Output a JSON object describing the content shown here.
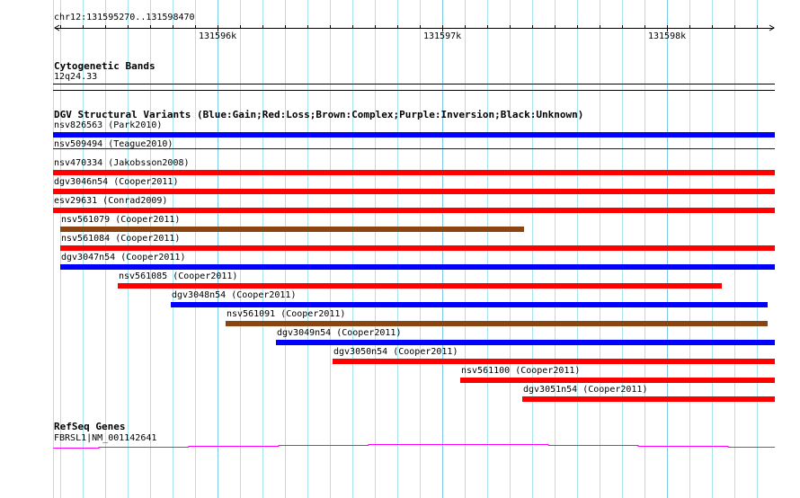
{
  "ruler": {
    "range_label": "chr12:131595270..131598470",
    "ticks": [
      "131596k",
      "131597k",
      "131598k"
    ]
  },
  "tracks": {
    "cytoband": {
      "title": "Cytogenetic Bands",
      "feature": "12q24.33"
    },
    "dgv": {
      "title": "DGV Structural Variants (Blue:Gain;Red:Loss;Brown:Complex;Purple:Inversion;Black:Unknown)",
      "colors": {
        "gain": "#0000ff",
        "loss": "#ff0000",
        "complex": "#8b4513"
      },
      "features": [
        {
          "label": "nsv826563 (Park2010)",
          "type": "gain"
        },
        {
          "label": "nsv509494 (Teague2010)",
          "type": "gain"
        },
        {
          "label": "nsv470334 (Jakobsson2008)",
          "type": "loss"
        },
        {
          "label": "dgv3046n54 (Cooper2011)",
          "type": "loss"
        },
        {
          "label": "esv29631 (Conrad2009)",
          "type": "loss"
        },
        {
          "label": "nsv561079 (Cooper2011)",
          "type": "complex"
        },
        {
          "label": "nsv561084 (Cooper2011)",
          "type": "loss"
        },
        {
          "label": "dgv3047n54 (Cooper2011)",
          "type": "gain"
        },
        {
          "label": "nsv561085 (Cooper2011)",
          "type": "loss"
        },
        {
          "label": "dgv3048n54 (Cooper2011)",
          "type": "gain"
        },
        {
          "label": "nsv561091 (Cooper2011)",
          "type": "complex"
        },
        {
          "label": "dgv3049n54 (Cooper2011)",
          "type": "gain"
        },
        {
          "label": "dgv3050n54 (Cooper2011)",
          "type": "loss"
        },
        {
          "label": "nsv561100 (Cooper2011)",
          "type": "loss"
        },
        {
          "label": "dgv3051n54 (Cooper2011)",
          "type": "loss"
        }
      ]
    },
    "refseq": {
      "title": "RefSeq Genes",
      "feature": "FBRSL1|NM_001142641",
      "color": "#ff00ff"
    }
  }
}
